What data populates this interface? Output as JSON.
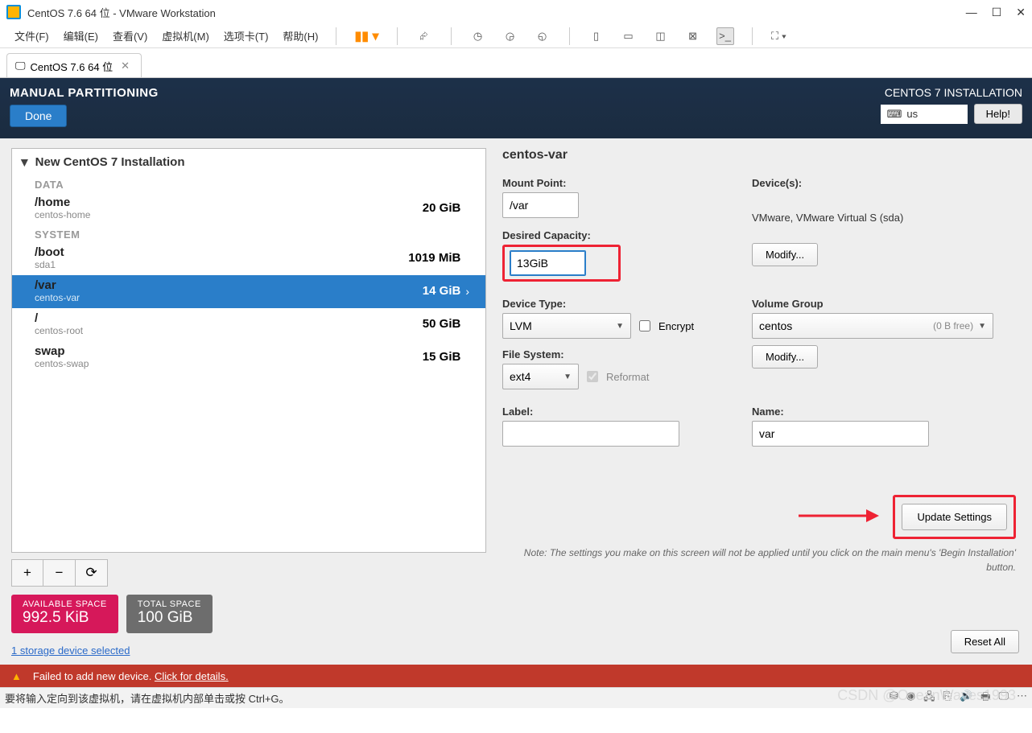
{
  "vmware": {
    "title": "CentOS 7.6 64 位 - VMware Workstation",
    "menus": [
      "文件(F)",
      "编辑(E)",
      "查看(V)",
      "虚拟机(M)",
      "选项卡(T)",
      "帮助(H)"
    ],
    "tab_label": "CentOS 7.6 64 位"
  },
  "header": {
    "title": "MANUAL PARTITIONING",
    "done": "Done",
    "install_title": "CENTOS 7 INSTALLATION",
    "lang": "us",
    "help": "Help!"
  },
  "partitions": {
    "heading": "New CentOS 7 Installation",
    "section_data": "DATA",
    "section_system": "SYSTEM",
    "items": [
      {
        "name": "/home",
        "sub": "centos-home",
        "size": "20 GiB",
        "selected": false
      },
      {
        "name": "/boot",
        "sub": "sda1",
        "size": "1019 MiB",
        "selected": false
      },
      {
        "name": "/var",
        "sub": "centos-var",
        "size": "14 GiB",
        "selected": true
      },
      {
        "name": "/",
        "sub": "centos-root",
        "size": "50 GiB",
        "selected": false
      },
      {
        "name": "swap",
        "sub": "centos-swap",
        "size": "15 GiB",
        "selected": false
      }
    ],
    "btn_add": "+",
    "btn_remove": "−",
    "btn_refresh": "⟳"
  },
  "space": {
    "avail_label": "AVAILABLE SPACE",
    "avail_value": "992.5 KiB",
    "total_label": "TOTAL SPACE",
    "total_value": "100 GiB",
    "storage_link": "1 storage device selected"
  },
  "detail": {
    "title": "centos-var",
    "mount_label": "Mount Point:",
    "mount_value": "/var",
    "capacity_label": "Desired Capacity:",
    "capacity_value": "13GiB",
    "devices_label": "Device(s):",
    "devices_text": "VMware, VMware Virtual S (sda)",
    "modify1": "Modify...",
    "devtype_label": "Device Type:",
    "devtype_value": "LVM",
    "encrypt": "Encrypt",
    "vg_label": "Volume Group",
    "vg_value": "centos",
    "vg_free": "(0 B free)",
    "modify2": "Modify...",
    "fs_label": "File System:",
    "fs_value": "ext4",
    "reformat": "Reformat",
    "label_label": "Label:",
    "label_value": "",
    "name_label": "Name:",
    "name_value": "var",
    "update": "Update Settings",
    "note": "Note:  The settings you make on this screen will not be applied until you click on the main menu's 'Begin Installation' button.",
    "reset": "Reset All"
  },
  "error": {
    "msg": "Failed to add new device.",
    "link": "Click for details."
  },
  "status": {
    "msg": "要将输入定向到该虚拟机，请在虚拟机内部单击或按 Ctrl+G。"
  },
  "watermark": "CSDN @OceanWaves1993"
}
